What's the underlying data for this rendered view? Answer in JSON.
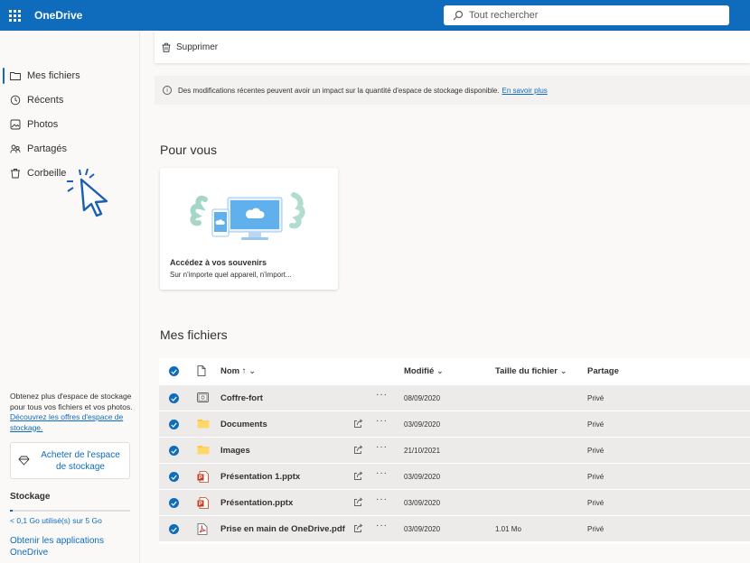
{
  "app": {
    "title": "OneDrive"
  },
  "search": {
    "placeholder": "Tout rechercher"
  },
  "sidebar": {
    "items": [
      {
        "label": "Mes fichiers",
        "icon": "folder-icon",
        "active": true
      },
      {
        "label": "Récents",
        "icon": "clock-icon"
      },
      {
        "label": "Photos",
        "icon": "image-icon"
      },
      {
        "label": "Partagés",
        "icon": "people-icon"
      },
      {
        "label": "Corbeille",
        "icon": "recycle-bin-icon"
      }
    ],
    "promo_text": "Obtenez plus d'espace de stockage pour tous vos fichiers et vos photos.",
    "promo_link": "Découvrez les offres d'espace de stockage.",
    "buy_button": "Acheter de l'espace de stockage",
    "storage_title": "Stockage",
    "storage_used_fraction": 0.02,
    "storage_text": "< 0,1 Go utilisé(s) sur 5 Go",
    "get_apps": "Obtenir les applications OneDrive"
  },
  "toolbar": {
    "delete_label": "Supprimer"
  },
  "info": {
    "message": "Des modifications récentes peuvent avoir un impact sur la quantité d'espace de stockage disponible.",
    "link": "En savoir plus"
  },
  "for_you": {
    "title": "Pour vous",
    "card_title": "Accédez à vos souvenirs",
    "card_subtitle": "Sur n'importe quel appareil, n'import..."
  },
  "files": {
    "title": "Mes fichiers",
    "columns": {
      "name": "Nom ↑",
      "modified": "Modifié",
      "size": "Taille du fichier",
      "sharing": "Partage"
    },
    "rows": [
      {
        "name": "Coffre-fort",
        "modified": "08/09/2020",
        "size": "",
        "sharing": "Privé",
        "icon": "vault-icon",
        "shareable": false
      },
      {
        "name": "Documents",
        "modified": "03/09/2020",
        "size": "",
        "sharing": "Privé",
        "icon": "folder-icon",
        "shareable": true
      },
      {
        "name": "Images",
        "modified": "21/10/2021",
        "size": "",
        "sharing": "Privé",
        "icon": "folder-icon",
        "shareable": true
      },
      {
        "name": "Présentation 1.pptx",
        "modified": "03/09/2020",
        "size": "",
        "sharing": "Privé",
        "icon": "powerpoint-icon",
        "shareable": true
      },
      {
        "name": "Présentation.pptx",
        "modified": "03/09/2020",
        "size": "",
        "sharing": "Privé",
        "icon": "powerpoint-icon",
        "shareable": true
      },
      {
        "name": "Prise en main de OneDrive.pdf",
        "modified": "03/09/2020",
        "size": "1.01 Mo",
        "sharing": "Privé",
        "icon": "pdf-icon",
        "shareable": true
      }
    ]
  },
  "colors": {
    "brand": "#0f6cbd",
    "row_selected": "#edebe9"
  }
}
